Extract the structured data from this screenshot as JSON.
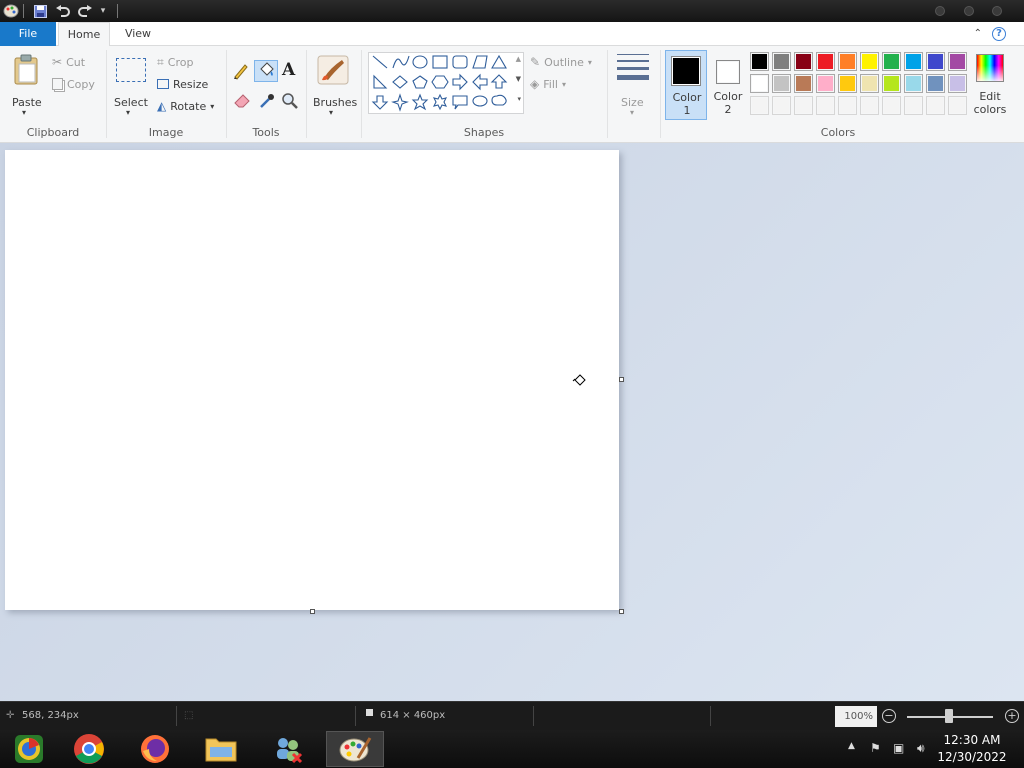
{
  "app": {
    "tabs": {
      "file": "File",
      "home": "Home",
      "view": "View"
    }
  },
  "clipboard": {
    "paste": "Paste",
    "cut": "Cut",
    "copy": "Copy",
    "label": "Clipboard"
  },
  "image": {
    "select": "Select",
    "crop": "Crop",
    "resize": "Resize",
    "rotate": "Rotate",
    "label": "Image"
  },
  "tools": {
    "label": "Tools"
  },
  "brushes": {
    "label": "Brushes"
  },
  "shapes": {
    "outline": "Outline",
    "fill": "Fill",
    "label": "Shapes"
  },
  "size": {
    "label": "Size"
  },
  "colors": {
    "color1": "Color\n1",
    "color1_line1": "Color",
    "color1_line2": "1",
    "color2_line1": "Color",
    "color2_line2": "2",
    "color1_value": "#000000",
    "color2_value": "#ffffff",
    "edit_line1": "Edit",
    "edit_line2": "colors",
    "label": "Colors",
    "palette_row1": [
      "#000000",
      "#7f7f7f",
      "#880015",
      "#ed1c24",
      "#ff7f27",
      "#fff200",
      "#22b14c",
      "#00a2e8",
      "#3f48cc",
      "#a349a4"
    ],
    "palette_row2": [
      "#ffffff",
      "#c3c3c3",
      "#b97a57",
      "#ffaec9",
      "#ffc90e",
      "#efe4b0",
      "#b5e61d",
      "#99d9ea",
      "#7092be",
      "#c8bfe7"
    ],
    "palette_row3": [
      "#f4f4f4",
      "#f4f4f4",
      "#f4f4f4",
      "#f4f4f4",
      "#f4f4f4",
      "#f4f4f4",
      "#f4f4f4",
      "#f4f4f4",
      "#f4f4f4",
      "#f4f4f4"
    ]
  },
  "status": {
    "cursor_pos": "568, 234px",
    "canvas_size": "614 × 460px",
    "zoom": "100%"
  },
  "taskbar": {
    "time": "12:30 AM",
    "date": "12/30/2022",
    "apps": [
      "start-orb",
      "chrome",
      "firefox",
      "file-explorer",
      "network-app",
      "paint"
    ]
  }
}
